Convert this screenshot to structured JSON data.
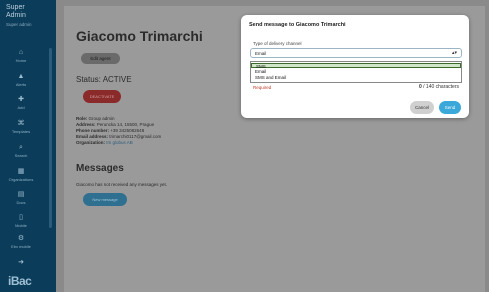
{
  "sidebar": {
    "brand_title_1": "Super",
    "brand_title_2": "Admin",
    "brand_subtitle": "Super admin",
    "items": [
      {
        "label": "Home",
        "icon": "home-icon",
        "glyph": "⌂"
      },
      {
        "label": "Alerts",
        "icon": "alert-icon",
        "glyph": "▲"
      },
      {
        "label": "Add",
        "icon": "add-icon",
        "glyph": "✚"
      },
      {
        "label": "Templates",
        "icon": "template-icon",
        "glyph": "⌘"
      },
      {
        "label": "Search",
        "icon": "search-icon",
        "glyph": "⌕"
      },
      {
        "label": "Organizations",
        "icon": "organization-icon",
        "glyph": "▦"
      },
      {
        "label": "Docs",
        "icon": "docs-icon",
        "glyph": "▤"
      },
      {
        "label": "Mobile",
        "icon": "mobile-icon",
        "glyph": "▯"
      },
      {
        "label": "Ebx mobile",
        "icon": "settings-icon",
        "glyph": "⚙"
      },
      {
        "label": "",
        "icon": "arrow-icon",
        "glyph": "➜"
      }
    ],
    "logo": "iBac"
  },
  "profile": {
    "name": "Giacomo Trimarchi",
    "edit_button": "Edit agent",
    "status_label": "Status:",
    "status_value": "ACTIVE",
    "deactivate_button": "DEACTIVATE",
    "role_label": "Role:",
    "role_value": "Group admin",
    "address_label": "Address:",
    "address_value": "Peruncka 14, 15500, Prague",
    "phone_label": "Phone number:",
    "phone_value": "+39 3425082648",
    "email_label": "Email address:",
    "email_value": "trimarchi0117@gmail.com",
    "org_label": "Organization:",
    "org_value": "Im globus AB"
  },
  "messages": {
    "title": "Messages",
    "empty_text": "Giacomo has not received any messages yet.",
    "new_button": "New message"
  },
  "modal": {
    "title": "Send message to Giacomo Trimarchi",
    "field_label": "Type of delivery channel",
    "selected_value": "Email",
    "options": [
      "SMS",
      "Email",
      "SMS and Email"
    ],
    "highlighted_option": "SMS",
    "required_text": "Required",
    "counter_current": "0",
    "counter_max": "/ 140 characters",
    "cancel_button": "Cancel",
    "send_button": "Send"
  }
}
